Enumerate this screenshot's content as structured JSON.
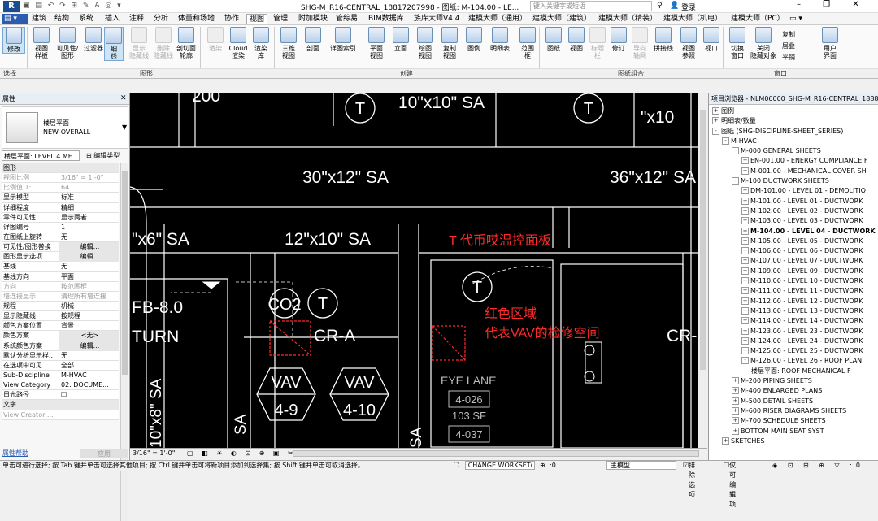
{
  "title_bar": {
    "app_title": "SHG-M_R16-CENTRAL_18817207998 - 图纸: M-104.00 - LE...",
    "search_placeholder": "键入关键字或短语",
    "login": "登录"
  },
  "ribbon_tabs": [
    "建筑",
    "结构",
    "系统",
    "插入",
    "注释",
    "分析",
    "体量和场地",
    "协作",
    "视图",
    "管理",
    "附加模块",
    "管综易",
    "BIM数据库",
    "族库大师V4.4",
    "建模大师（通用）",
    "建模大师（建筑）",
    "建模大师（精装）",
    "建模大师（机电）",
    "建模大师（PC）"
  ],
  "active_tab": "视图",
  "ribbon": {
    "buttons": [
      "修改",
      "视图\n样板",
      "可见性/\n图形",
      "过滤器",
      "细\n线",
      "显示\n隐藏线",
      "删除\n隐藏线",
      "剖切面\n轮廓",
      "渲染",
      "Cloud\n渲染",
      "渲染\n库",
      "三维\n视图",
      "剖面",
      "详图索引",
      "平面\n视图",
      "立面",
      "绘图\n视图",
      "复制\n视图",
      "图例",
      "明细表",
      "范围\n框",
      "图纸",
      "视图",
      "标题\n栏",
      "修订",
      "导向\n轴网",
      "拼接线",
      "视图\n参照",
      "视口",
      "切换\n窗口",
      "关闭\n隐藏对象",
      "复制",
      "层叠",
      "平铺",
      "用户\n界面"
    ],
    "groups": [
      "选择",
      "图形",
      "创建",
      "图纸组合",
      "窗口"
    ]
  },
  "properties": {
    "header": "属性",
    "family_line1": "楼层平面",
    "family_line2": "NEW-OVERALL",
    "view_selector": "楼层平面: LEVEL 4 ME",
    "edit_type": "编辑类型",
    "rows": [
      {
        "k": "图形",
        "v": "",
        "sec": true
      },
      {
        "k": "视图比例",
        "v": "3/16\" = 1'-0\"",
        "gray": true
      },
      {
        "k": "比例值 1:",
        "v": "64",
        "gray": true
      },
      {
        "k": "显示模型",
        "v": "标准"
      },
      {
        "k": "详细程度",
        "v": "精细"
      },
      {
        "k": "零件可见性",
        "v": "显示两者"
      },
      {
        "k": "详图编号",
        "v": "1"
      },
      {
        "k": "在图纸上旋转",
        "v": "无"
      },
      {
        "k": "可见性/图形替换",
        "v": "编辑...",
        "btn": true
      },
      {
        "k": "图形显示选项",
        "v": "编辑...",
        "btn": true
      },
      {
        "k": "基线",
        "v": "无"
      },
      {
        "k": "基线方向",
        "v": "平面"
      },
      {
        "k": "方向",
        "v": "按范围框",
        "gray": true
      },
      {
        "k": "墙连接显示",
        "v": "清理所有墙连接",
        "gray": true
      },
      {
        "k": "规程",
        "v": "机械"
      },
      {
        "k": "显示隐藏线",
        "v": "按规程"
      },
      {
        "k": "颜色方案位置",
        "v": "背景"
      },
      {
        "k": "颜色方案",
        "v": "<无>",
        "btn": true
      },
      {
        "k": "系统颜色方案",
        "v": "编辑...",
        "btn": true
      },
      {
        "k": "默认分析显示样...",
        "v": "无"
      },
      {
        "k": "在选项中可见",
        "v": "全部"
      },
      {
        "k": "Sub-Discipline",
        "v": "M-HVAC"
      },
      {
        "k": "View Category",
        "v": "02. DOCUME..."
      },
      {
        "k": "日光路径",
        "v": "☐"
      },
      {
        "k": "文字",
        "v": "",
        "sec": true
      },
      {
        "k": "View Creator ...",
        "v": "",
        "gray": true
      }
    ],
    "help": "属性帮助",
    "apply": "应用"
  },
  "drawing": {
    "ducts": [
      "30\"x12\" SA",
      "36\"x12\" SA",
      "\"x6\" SA",
      "12\"x10\" SA",
      "10\"x10\" SA",
      "\"x10",
      "10\"x8\" SA",
      "SA",
      "SA",
      "200"
    ],
    "thermostats": [
      "T",
      "T",
      "T",
      "T"
    ],
    "co2": "CO2",
    "returns": [
      "CR-A",
      "CR-"
    ],
    "vavs": [
      {
        "top": "VAV",
        "bot": "4-9"
      },
      {
        "top": "VAV",
        "bot": "4-10"
      }
    ],
    "room_name": "EYE LANE",
    "room_tags": [
      "4-026",
      "103 SF",
      "4-037"
    ],
    "fb_text": "FB-8.0",
    "turn_text": "TURN",
    "annot_t": "T 代币哎温控面板",
    "annot_red1": "红色区域",
    "annot_red2": "代表VAV的检修空间",
    "annot_color": "#ff2a2a"
  },
  "view_bar": {
    "scale": "3/16\" = 1'-0\""
  },
  "project_browser": {
    "header": "项目浏览器 - NLM06000_SHG-M_R16-CENTRAL_1888...",
    "nodes": [
      {
        "label": "图例",
        "tw": "+",
        "lvl": 0
      },
      {
        "label": "明细表/数量",
        "tw": "+",
        "lvl": 0
      },
      {
        "label": "图纸 (SHG-DISCIPLINE-SHEET_SERIES)",
        "tw": "-",
        "lvl": 0
      },
      {
        "label": "M-HVAC",
        "tw": "-",
        "lvl": 1
      },
      {
        "label": "M-000 GENERAL SHEETS",
        "tw": "-",
        "lvl": 2
      },
      {
        "label": "EN-001.00 - ENERGY COMPLIANCE F",
        "tw": "+",
        "lvl": 3
      },
      {
        "label": "M-001.00 - MECHANICAL COVER SH",
        "tw": "+",
        "lvl": 3
      },
      {
        "label": "M-100 DUCTWORK SHEETS",
        "tw": "-",
        "lvl": 2
      },
      {
        "label": "DM-101.00 - LEVEL 01 - DEMOLITIO",
        "tw": "+",
        "lvl": 3
      },
      {
        "label": "M-101.00 - LEVEL 01 - DUCTWORK",
        "tw": "+",
        "lvl": 3
      },
      {
        "label": "M-102.00 - LEVEL 02 - DUCTWORK",
        "tw": "+",
        "lvl": 3
      },
      {
        "label": "M-103.00 - LEVEL 03 - DUCTWORK",
        "tw": "+",
        "lvl": 3
      },
      {
        "label": "M-104.00 - LEVEL 04 - DUCTWORK",
        "tw": "+",
        "lvl": 3,
        "bold": true
      },
      {
        "label": "M-105.00 - LEVEL 05 - DUCTWORK",
        "tw": "+",
        "lvl": 3
      },
      {
        "label": "M-106.00 - LEVEL 06 - DUCTWORK",
        "tw": "+",
        "lvl": 3
      },
      {
        "label": "M-107.00 - LEVEL 07 - DUCTWORK",
        "tw": "+",
        "lvl": 3
      },
      {
        "label": "M-109.00 - LEVEL 09 - DUCTWORK",
        "tw": "+",
        "lvl": 3
      },
      {
        "label": "M-110.00 - LEVEL 10 - DUCTWORK",
        "tw": "+",
        "lvl": 3
      },
      {
        "label": "M-111.00 - LEVEL 11 - DUCTWORK",
        "tw": "+",
        "lvl": 3
      },
      {
        "label": "M-112.00 - LEVEL 12 - DUCTWORK",
        "tw": "+",
        "lvl": 3
      },
      {
        "label": "M-113.00 - LEVEL 13 - DUCTWORK",
        "tw": "+",
        "lvl": 3
      },
      {
        "label": "M-114.00 - LEVEL 14 - DUCTWORK",
        "tw": "+",
        "lvl": 3
      },
      {
        "label": "M-123.00 - LEVEL 23 - DUCTWORK",
        "tw": "+",
        "lvl": 3
      },
      {
        "label": "M-124.00 - LEVEL 24 - DUCTWORK",
        "tw": "+",
        "lvl": 3
      },
      {
        "label": "M-125.00 - LEVEL 25 - DUCTWORK",
        "tw": "+",
        "lvl": 3
      },
      {
        "label": "M-126.00 - LEVEL 26 - ROOF PLAN",
        "tw": "-",
        "lvl": 3
      },
      {
        "label": "楼层平面: ROOF MECHANICAL F",
        "tw": "",
        "lvl": 4
      },
      {
        "label": "M-200 PIPING SHEETS",
        "tw": "+",
        "lvl": 2
      },
      {
        "label": "M-400 ENLARGED PLANS",
        "tw": "+",
        "lvl": 2
      },
      {
        "label": "M-500 DETAIL SHEETS",
        "tw": "+",
        "lvl": 2
      },
      {
        "label": "M-600 RISER DIAGRAMS SHEETS",
        "tw": "+",
        "lvl": 2
      },
      {
        "label": "M-700 SCHEDULE SHEETS",
        "tw": "+",
        "lvl": 2
      },
      {
        "label": "BOTTOM MAIN SEAT SYST",
        "tw": "+",
        "lvl": 2
      },
      {
        "label": "SKETCHES",
        "tw": "+",
        "lvl": 1
      }
    ]
  },
  "status_bar": {
    "hint": "单击可进行选择; 按 Tab 键并单击可选择其他项目; 按 Ctrl 键并单击可将新项目添加到选择集; 按 Shift 键并单击可取消选择。",
    "workset": ":CHANGE WORKSET(",
    "zero": ":0",
    "model": "主模型",
    "exclude": "排除选项",
    "editable_only": "仅可编辑项"
  }
}
